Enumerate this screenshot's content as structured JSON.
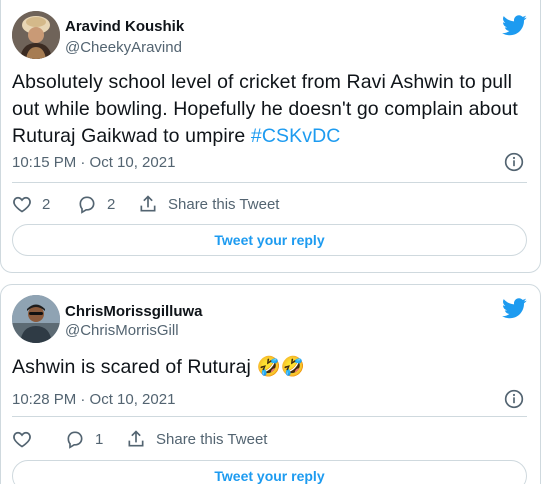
{
  "tweets": [
    {
      "author_name": "Aravind Koushik",
      "author_handle": "@CheekyAravind",
      "text_plain": "Absolutely school level of cricket from Ravi Ashwin to pull out while bowling. Hopefully he doesn't go complain about Ruturaj Gaikwad to umpire ",
      "hashtag": "#CSKvDC",
      "timestamp": "10:15 PM · Oct 10, 2021",
      "like_count": "2",
      "reply_count": "2",
      "share_label": "Share this Tweet",
      "reply_button_label": "Tweet your reply",
      "avatar_icon": "avatar-turban-icon"
    },
    {
      "author_name": "ChrisMorissgilluwa",
      "author_handle": "@ChrisMorrisGill",
      "text_plain": "Ashwin is scared of Ruturaj ",
      "emoji": "🤣🤣",
      "timestamp": "10:28 PM · Oct 10, 2021",
      "like_count": "",
      "reply_count": "1",
      "share_label": "Share this Tweet",
      "reply_button_label": "Tweet your reply",
      "avatar_icon": "avatar-cricketer-icon"
    }
  ],
  "colors": {
    "twitter_blue": "#1d9bf0",
    "text_primary": "#0f1419",
    "text_secondary": "#536471",
    "border": "#cfd9de"
  },
  "icons": [
    "twitter-bird-icon",
    "info-icon",
    "like-heart-icon",
    "reply-bubble-icon",
    "share-icon"
  ]
}
